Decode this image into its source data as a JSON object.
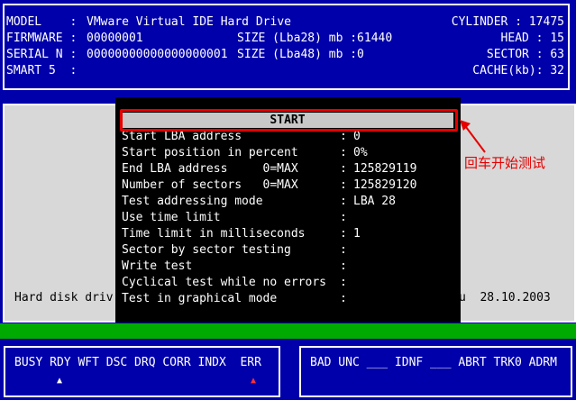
{
  "info": {
    "model_label": "MODEL    :",
    "model_value": "VMware Virtual IDE Hard Drive",
    "firmware_label": "FIRMWARE :",
    "firmware_value": "00000001",
    "serial_label": "SERIAL N :",
    "serial_value": "00000000000000000001",
    "smart_label": "SMART 5  :",
    "lba28_label": "SIZE (Lba28) mb :61440",
    "lba48_label": "SIZE (Lba48) mb :0",
    "cylinder": "CYLINDER : 17475",
    "head": "HEAD : 15",
    "sector": "SECTOR : 63",
    "cache": "CACHE(kb): 32"
  },
  "background": {
    "left_text": "Hard disk driv",
    "right_text": "u  28.10.2003"
  },
  "dialog": {
    "start_label": "START",
    "rows": [
      {
        "label": "Start LBA address",
        "sep": ":",
        "value": "0"
      },
      {
        "label": "Start position in percent",
        "sep": ":",
        "value": "0%"
      },
      {
        "label": "End LBA address     0=MAX",
        "sep": ":",
        "value": "125829119"
      },
      {
        "label": "Number of sectors   0=MAX",
        "sep": ":",
        "value": "125829120"
      },
      {
        "label": "Test addressing mode",
        "sep": ":",
        "value": "LBA 28"
      },
      {
        "label": "Use time limit",
        "sep": ":",
        "value": ""
      },
      {
        "label": "Time limit in milliseconds",
        "sep": ":",
        "value": "1"
      },
      {
        "label": "Sector by sector testing",
        "sep": ":",
        "value": ""
      },
      {
        "label": "Write test",
        "sep": ":",
        "value": ""
      },
      {
        "label": "Cyclical test while no errors",
        "sep": ":",
        "value": ""
      },
      {
        "label": "Test in graphical mode",
        "sep": ":",
        "value": ""
      }
    ]
  },
  "annotation": {
    "note": "回车开始测试",
    "color": "#e60000"
  },
  "status_left": {
    "flags": "BUSY RDY WFT DSC DRQ CORR INDX  ERR",
    "rdy_marker": "▲",
    "err_marker": "▲"
  },
  "status_right": {
    "flags": "BAD UNC ___ IDNF ___ ABRT TRK0 ADRM"
  }
}
